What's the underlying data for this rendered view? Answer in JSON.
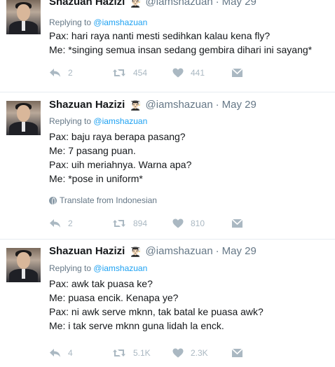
{
  "colors": {
    "link": "#1da1f2",
    "muted": "#657786",
    "icon": "#aab8c2",
    "divider": "#e6ecf0"
  },
  "tweets": [
    {
      "author_name": "Shazuan Hazizi",
      "badge": "👨🏻‍🎓",
      "handle": "@iamshazuan",
      "separator": "·",
      "date": "May 29",
      "replying_prefix": "Replying to",
      "replying_to": "@iamshazuan",
      "lines": [
        "Pax: hari raya nanti mesti sedihkan kalau kena fly?",
        "Me: *singing semua insan sedang gembira dihari ini sayang*"
      ],
      "translate": "",
      "replies": "2",
      "retweets": "454",
      "likes": "441"
    },
    {
      "author_name": "Shazuan Hazizi",
      "badge": "👨🏻‍🎓",
      "handle": "@iamshazuan",
      "separator": "·",
      "date": "May 29",
      "replying_prefix": "Replying to",
      "replying_to": "@iamshazuan",
      "lines": [
        "Pax: baju raya berapa pasang?",
        "Me: 7 pasang puan.",
        "Pax: uih meriahnya. Warna apa?",
        "Me: *pose in uniform*"
      ],
      "translate": "Translate from Indonesian",
      "replies": "2",
      "retweets": "894",
      "likes": "810"
    },
    {
      "author_name": "Shazuan Hazizi",
      "badge": "👨🏻‍🎓",
      "handle": "@iamshazuan",
      "separator": "·",
      "date": "May 29",
      "replying_prefix": "Replying to",
      "replying_to": "@iamshazuan",
      "lines": [
        "Pax: awk tak puasa ke?",
        "Me: puasa encik. Kenapa ye?",
        "Pax: ni awk serve mknn, tak batal ke puasa awk?",
        "Me: i tak serve mknn guna lidah la enck."
      ],
      "translate": "",
      "replies": "4",
      "retweets": "5.1K",
      "likes": "2.3K"
    }
  ]
}
